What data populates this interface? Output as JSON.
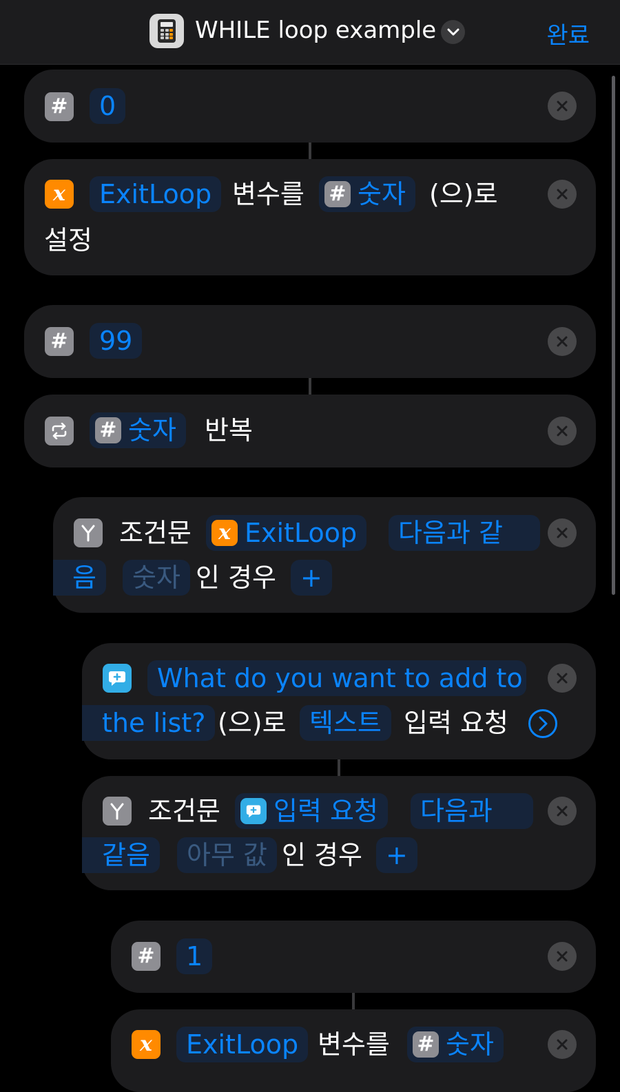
{
  "header": {
    "title": "WHILE loop example",
    "done_label": "완료"
  },
  "actions": {
    "number_0": {
      "value": "0"
    },
    "set_variable": {
      "var_name": "ExitLoop",
      "text1": "변수를",
      "magic_var": "숫자",
      "text2": "(으)로",
      "text3": "설정"
    },
    "number_99": {
      "value": "99"
    },
    "repeat": {
      "magic_var": "숫자",
      "text": "반복"
    },
    "if_1": {
      "label": "조건문",
      "var_name": "ExitLoop",
      "cond_a": "다음과 같",
      "cond_b": "음",
      "value": "숫자",
      "text": "인 경우",
      "plus": "+"
    },
    "ask": {
      "prompt_a": "What do you want to add to",
      "prompt_b": "the list?",
      "text1": "(으)로",
      "type": "텍스트",
      "text2": "입력 요청"
    },
    "if_2": {
      "label": "조건문",
      "var_name": "입력 요청",
      "cond_a": "다음과",
      "cond_b": "같음",
      "value": "아무 값",
      "text": "인 경우",
      "plus": "+"
    },
    "number_1": {
      "value": "1"
    },
    "set_variable_2": {
      "var_name": "ExitLoop",
      "text1": "변수를",
      "magic_var": "숫자"
    }
  },
  "icons": [
    "calculator-icon",
    "chevron-down-icon",
    "number-icon",
    "variable-icon",
    "repeat-icon",
    "if-icon",
    "ask-input-icon",
    "close-icon",
    "chevron-right-circle-icon"
  ],
  "colors": {
    "accent": "#0a84ff",
    "variable": "#ff8a00",
    "ask": "#32ade6",
    "card": "#1c1c1e",
    "background": "#000000"
  }
}
